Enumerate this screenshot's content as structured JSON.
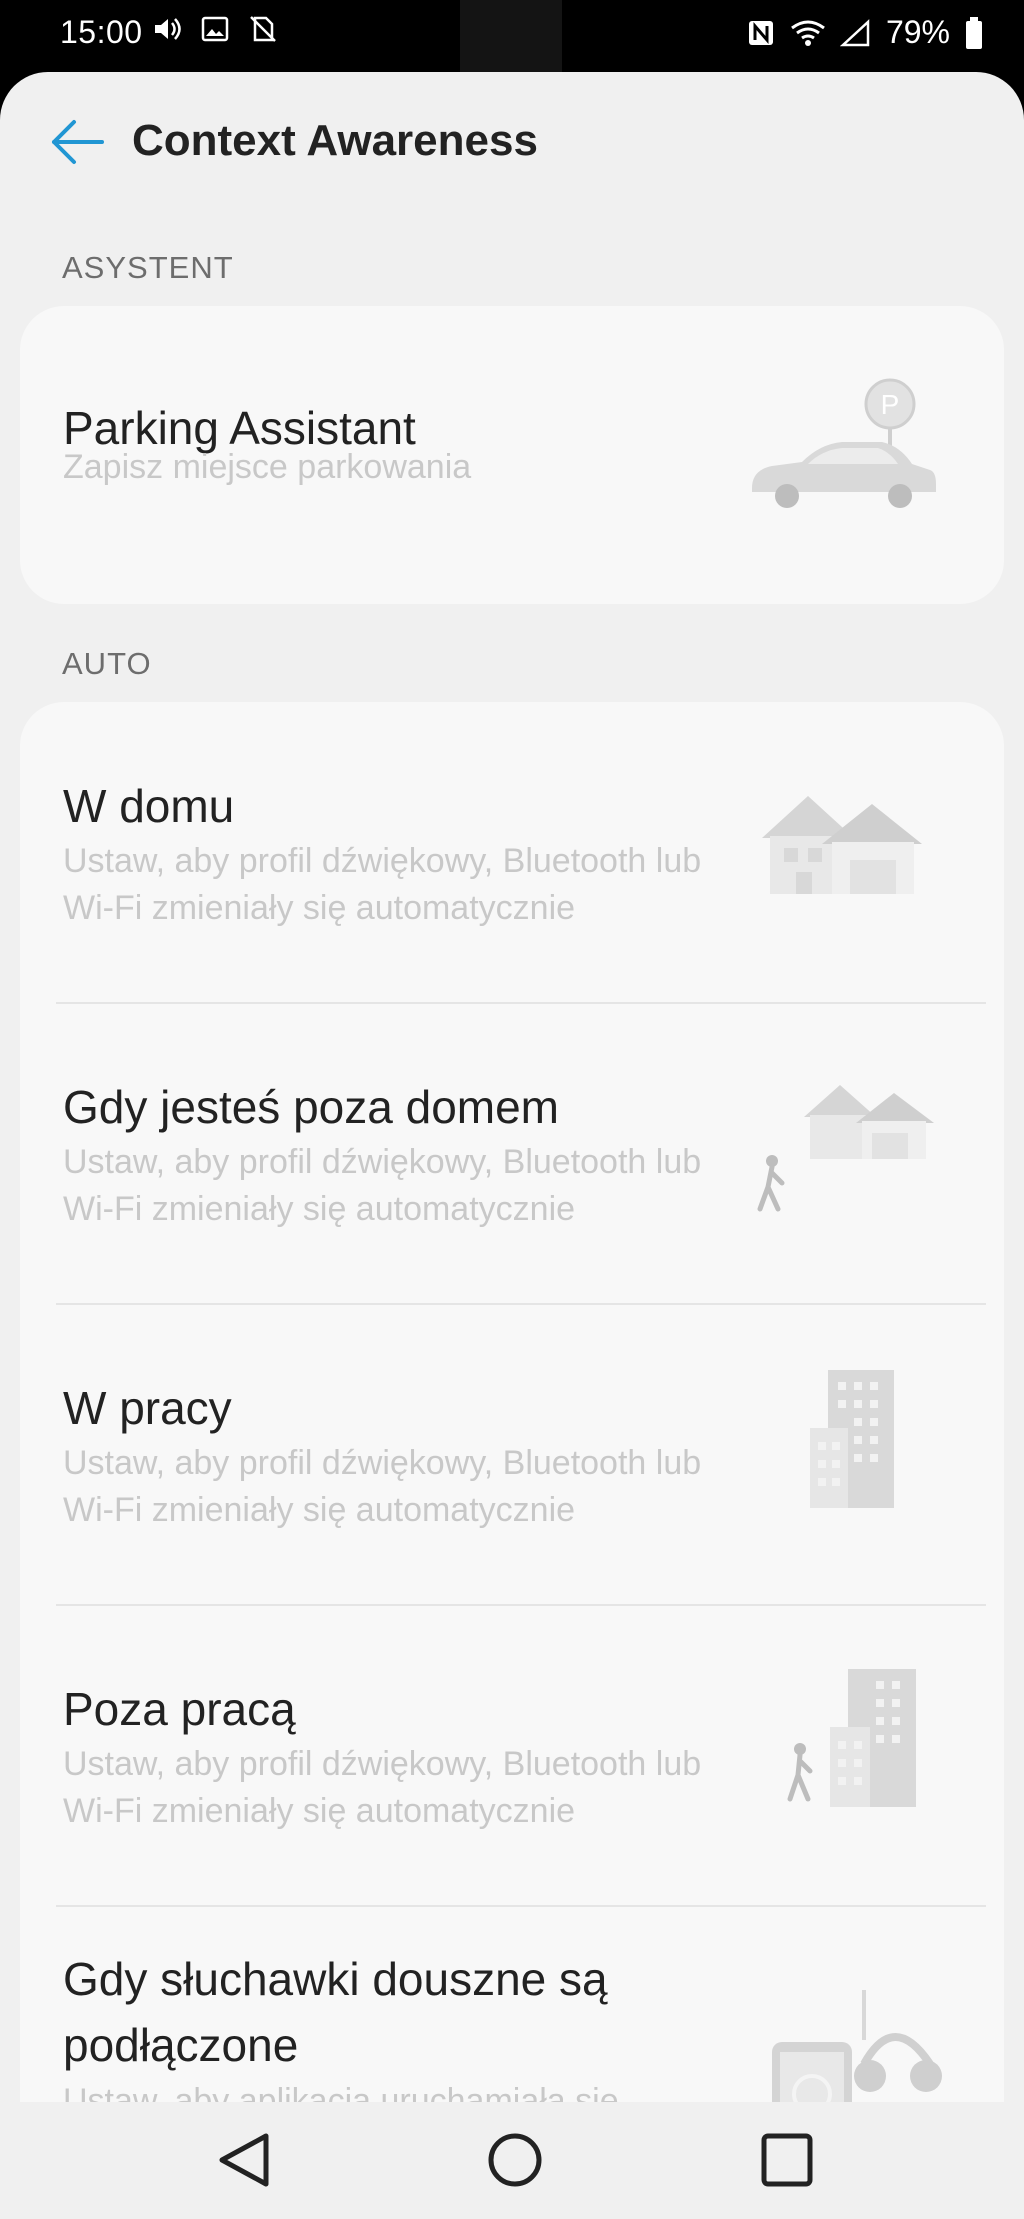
{
  "status_bar": {
    "time": "15:00",
    "battery": "79%",
    "icons_left": [
      "volume-icon",
      "image-icon",
      "no-sim-icon"
    ],
    "icons_right": [
      "nfc-icon",
      "wifi-icon",
      "signal-icon",
      "battery-icon"
    ]
  },
  "app_bar": {
    "title": "Context Awareness",
    "accent_color": "#2196d3"
  },
  "sections": {
    "assistant_label": "ASYSTENT",
    "auto_label": "AUTO"
  },
  "parking": {
    "title": "Parking Assistant",
    "subtitle": "Zapisz miejsce parkowania",
    "sign_letter": "P"
  },
  "auto_items": [
    {
      "title": "W domu",
      "subtitle": "Ustaw, aby profil dźwiękowy, Bluetooth lub Wi-Fi zmieniały się automatycznie"
    },
    {
      "title": "Gdy jesteś poza domem",
      "subtitle": "Ustaw, aby profil dźwiękowy, Bluetooth lub Wi-Fi zmieniały się automatycznie"
    },
    {
      "title": "W pracy",
      "subtitle": "Ustaw, aby profil dźwiękowy, Bluetooth lub Wi-Fi zmieniały się automatycznie"
    },
    {
      "title": "Poza pracą",
      "subtitle": "Ustaw, aby profil dźwiękowy, Bluetooth lub Wi-Fi zmieniały się automatycznie"
    },
    {
      "title": "Gdy słuchawki douszne są podłączone",
      "subtitle": "Ustaw, aby aplikacja uruchamiała się"
    }
  ],
  "nav_bar": {
    "buttons": [
      "back-nav-icon",
      "home-nav-icon",
      "recents-nav-icon"
    ]
  }
}
